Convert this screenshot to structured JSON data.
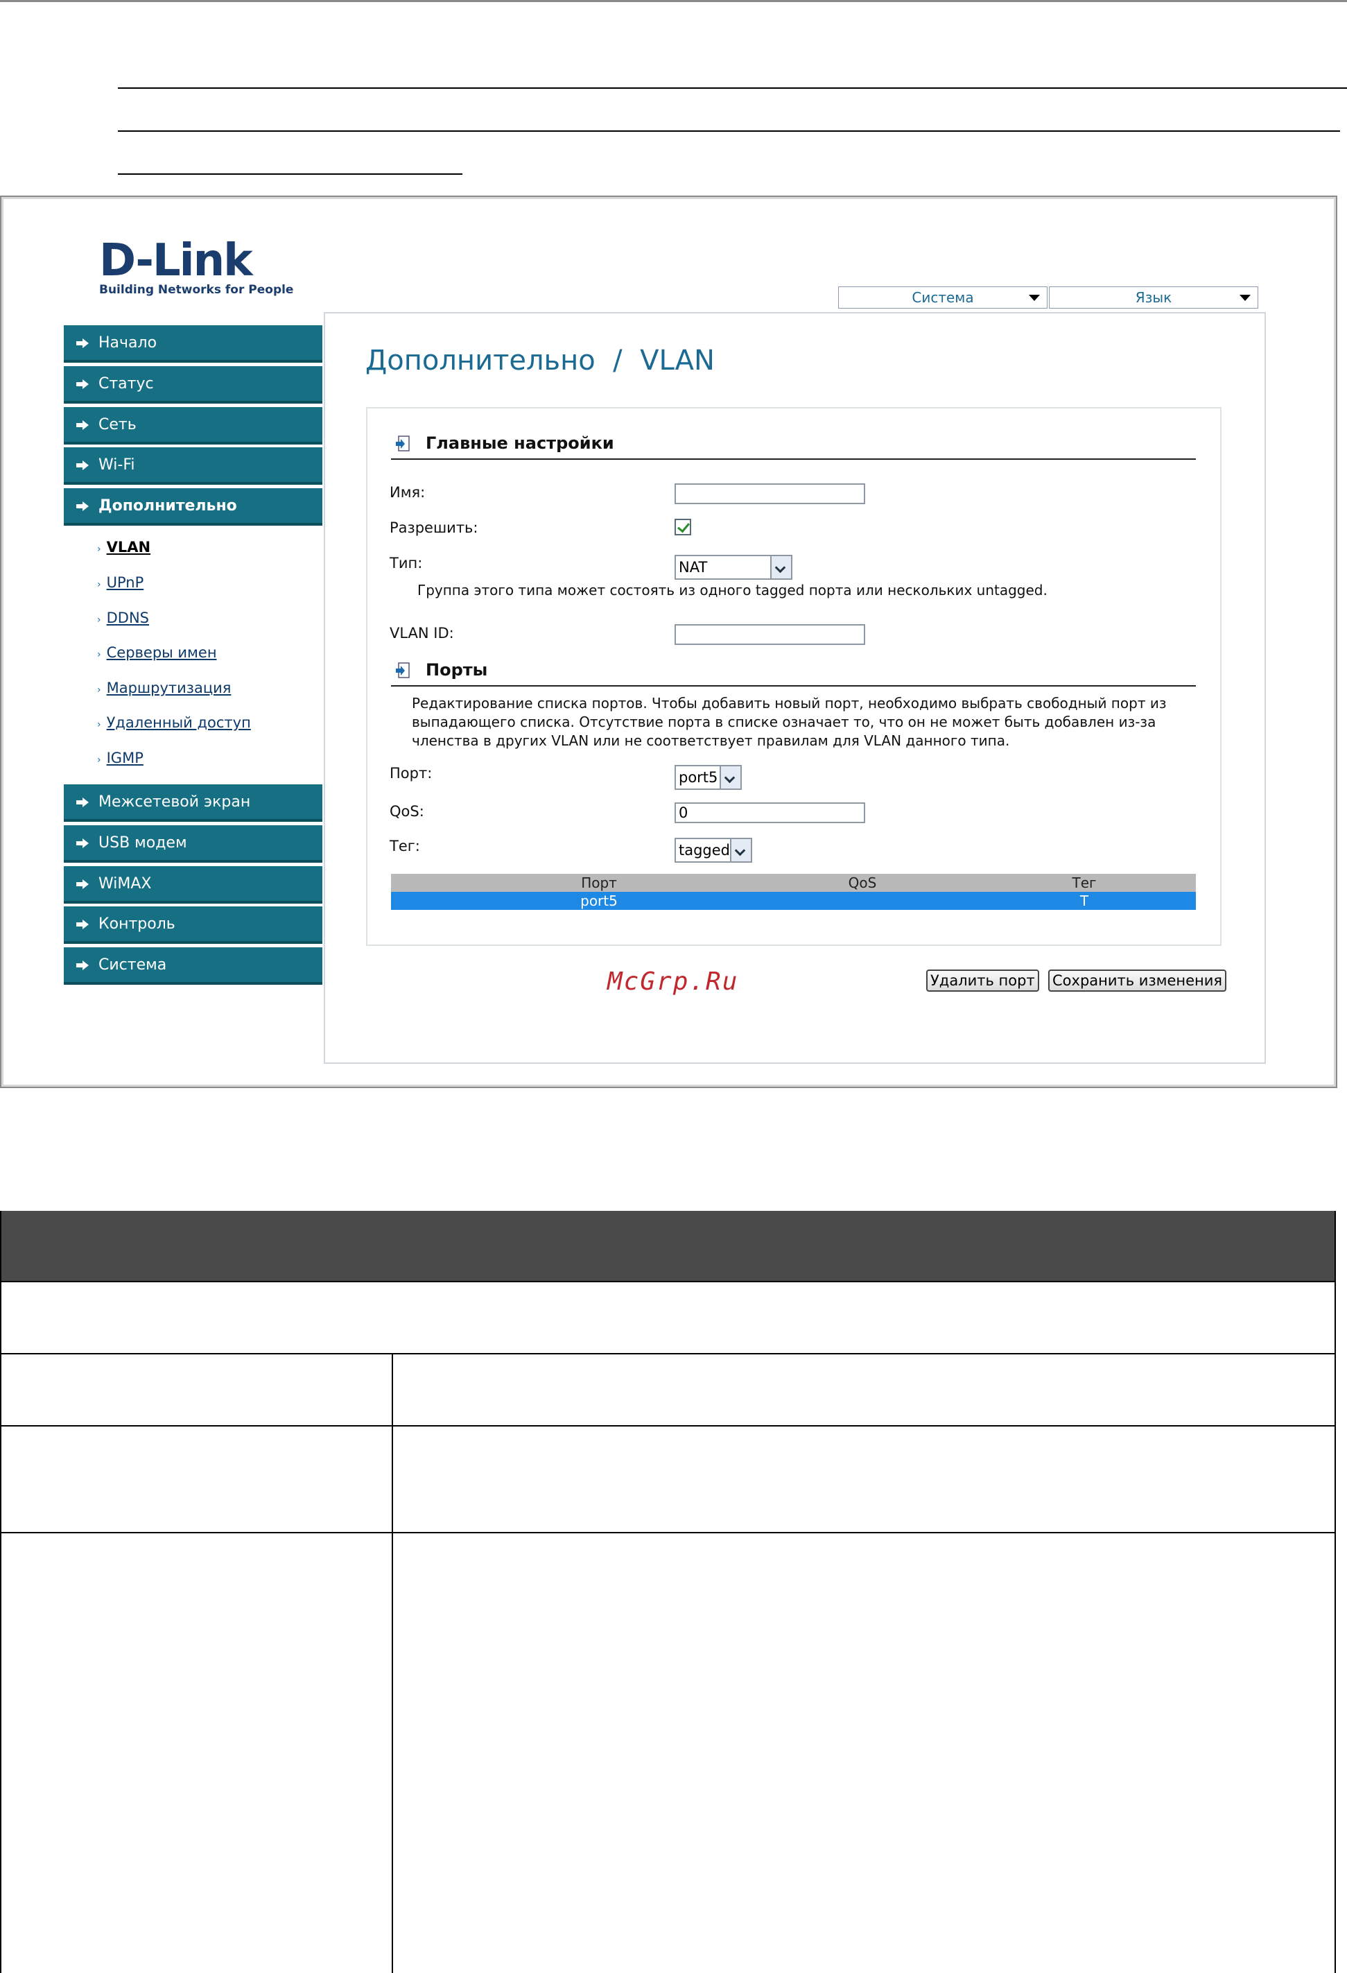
{
  "logo": {
    "brand": "D-Link",
    "tagline": "Building Networks for People"
  },
  "top_menus": [
    {
      "label": "Система"
    },
    {
      "label": "Язык"
    }
  ],
  "sidebar": {
    "items": [
      {
        "label": "Начало"
      },
      {
        "label": "Статус"
      },
      {
        "label": "Сеть"
      },
      {
        "label": "Wi-Fi"
      },
      {
        "label": "Дополнительно"
      },
      {
        "label": "Межсетевой экран"
      },
      {
        "label": "USB модем"
      },
      {
        "label": "WiMAX"
      },
      {
        "label": "Контроль"
      },
      {
        "label": "Система"
      }
    ],
    "subitems": [
      {
        "label": "VLAN"
      },
      {
        "label": "UPnP"
      },
      {
        "label": "DDNS"
      },
      {
        "label": "Серверы имен"
      },
      {
        "label": "Маршрутизация"
      },
      {
        "label": "Удаленный доступ"
      },
      {
        "label": "IGMP"
      }
    ]
  },
  "page_title": "Дополнительно  /  VLAN",
  "main_settings": {
    "heading": "Главные настройки",
    "name_label": "Имя:",
    "name_value": "",
    "enable_label": "Разрешить:",
    "enable_checked": true,
    "type_label": "Тип:",
    "type_value": "NAT",
    "type_hint": "Группа этого типа может состоять из одного tagged порта или нескольких untagged.",
    "vlanid_label": "VLAN ID:",
    "vlanid_value": ""
  },
  "ports": {
    "heading": "Порты",
    "description": "Редактирование списка портов. Чтобы добавить новый порт, необходимо выбрать свободный порт из выпадающего списка. Отсутствие порта в списке означает то, что он не может быть добавлен из-за членства в других VLAN или не соответствует правилам для VLAN данного типа.",
    "port_label": "Порт:",
    "port_value": "port5",
    "qos_label": "QoS:",
    "qos_value": "0",
    "tag_label": "Тег:",
    "tag_value": "tagged",
    "table": {
      "columns": [
        "Порт",
        "QoS",
        "Тег"
      ],
      "rows": [
        [
          "port5",
          "",
          "T"
        ]
      ]
    }
  },
  "buttons": {
    "delete_port": "Удалить порт",
    "save": "Сохранить изменения"
  },
  "watermark": "McGrp.Ru",
  "colors": {
    "nav_teal": "#176f83",
    "title_blue": "#1a6a94",
    "row_selected": "#1e88e5",
    "doc_table_header": "#4a4a4a"
  }
}
